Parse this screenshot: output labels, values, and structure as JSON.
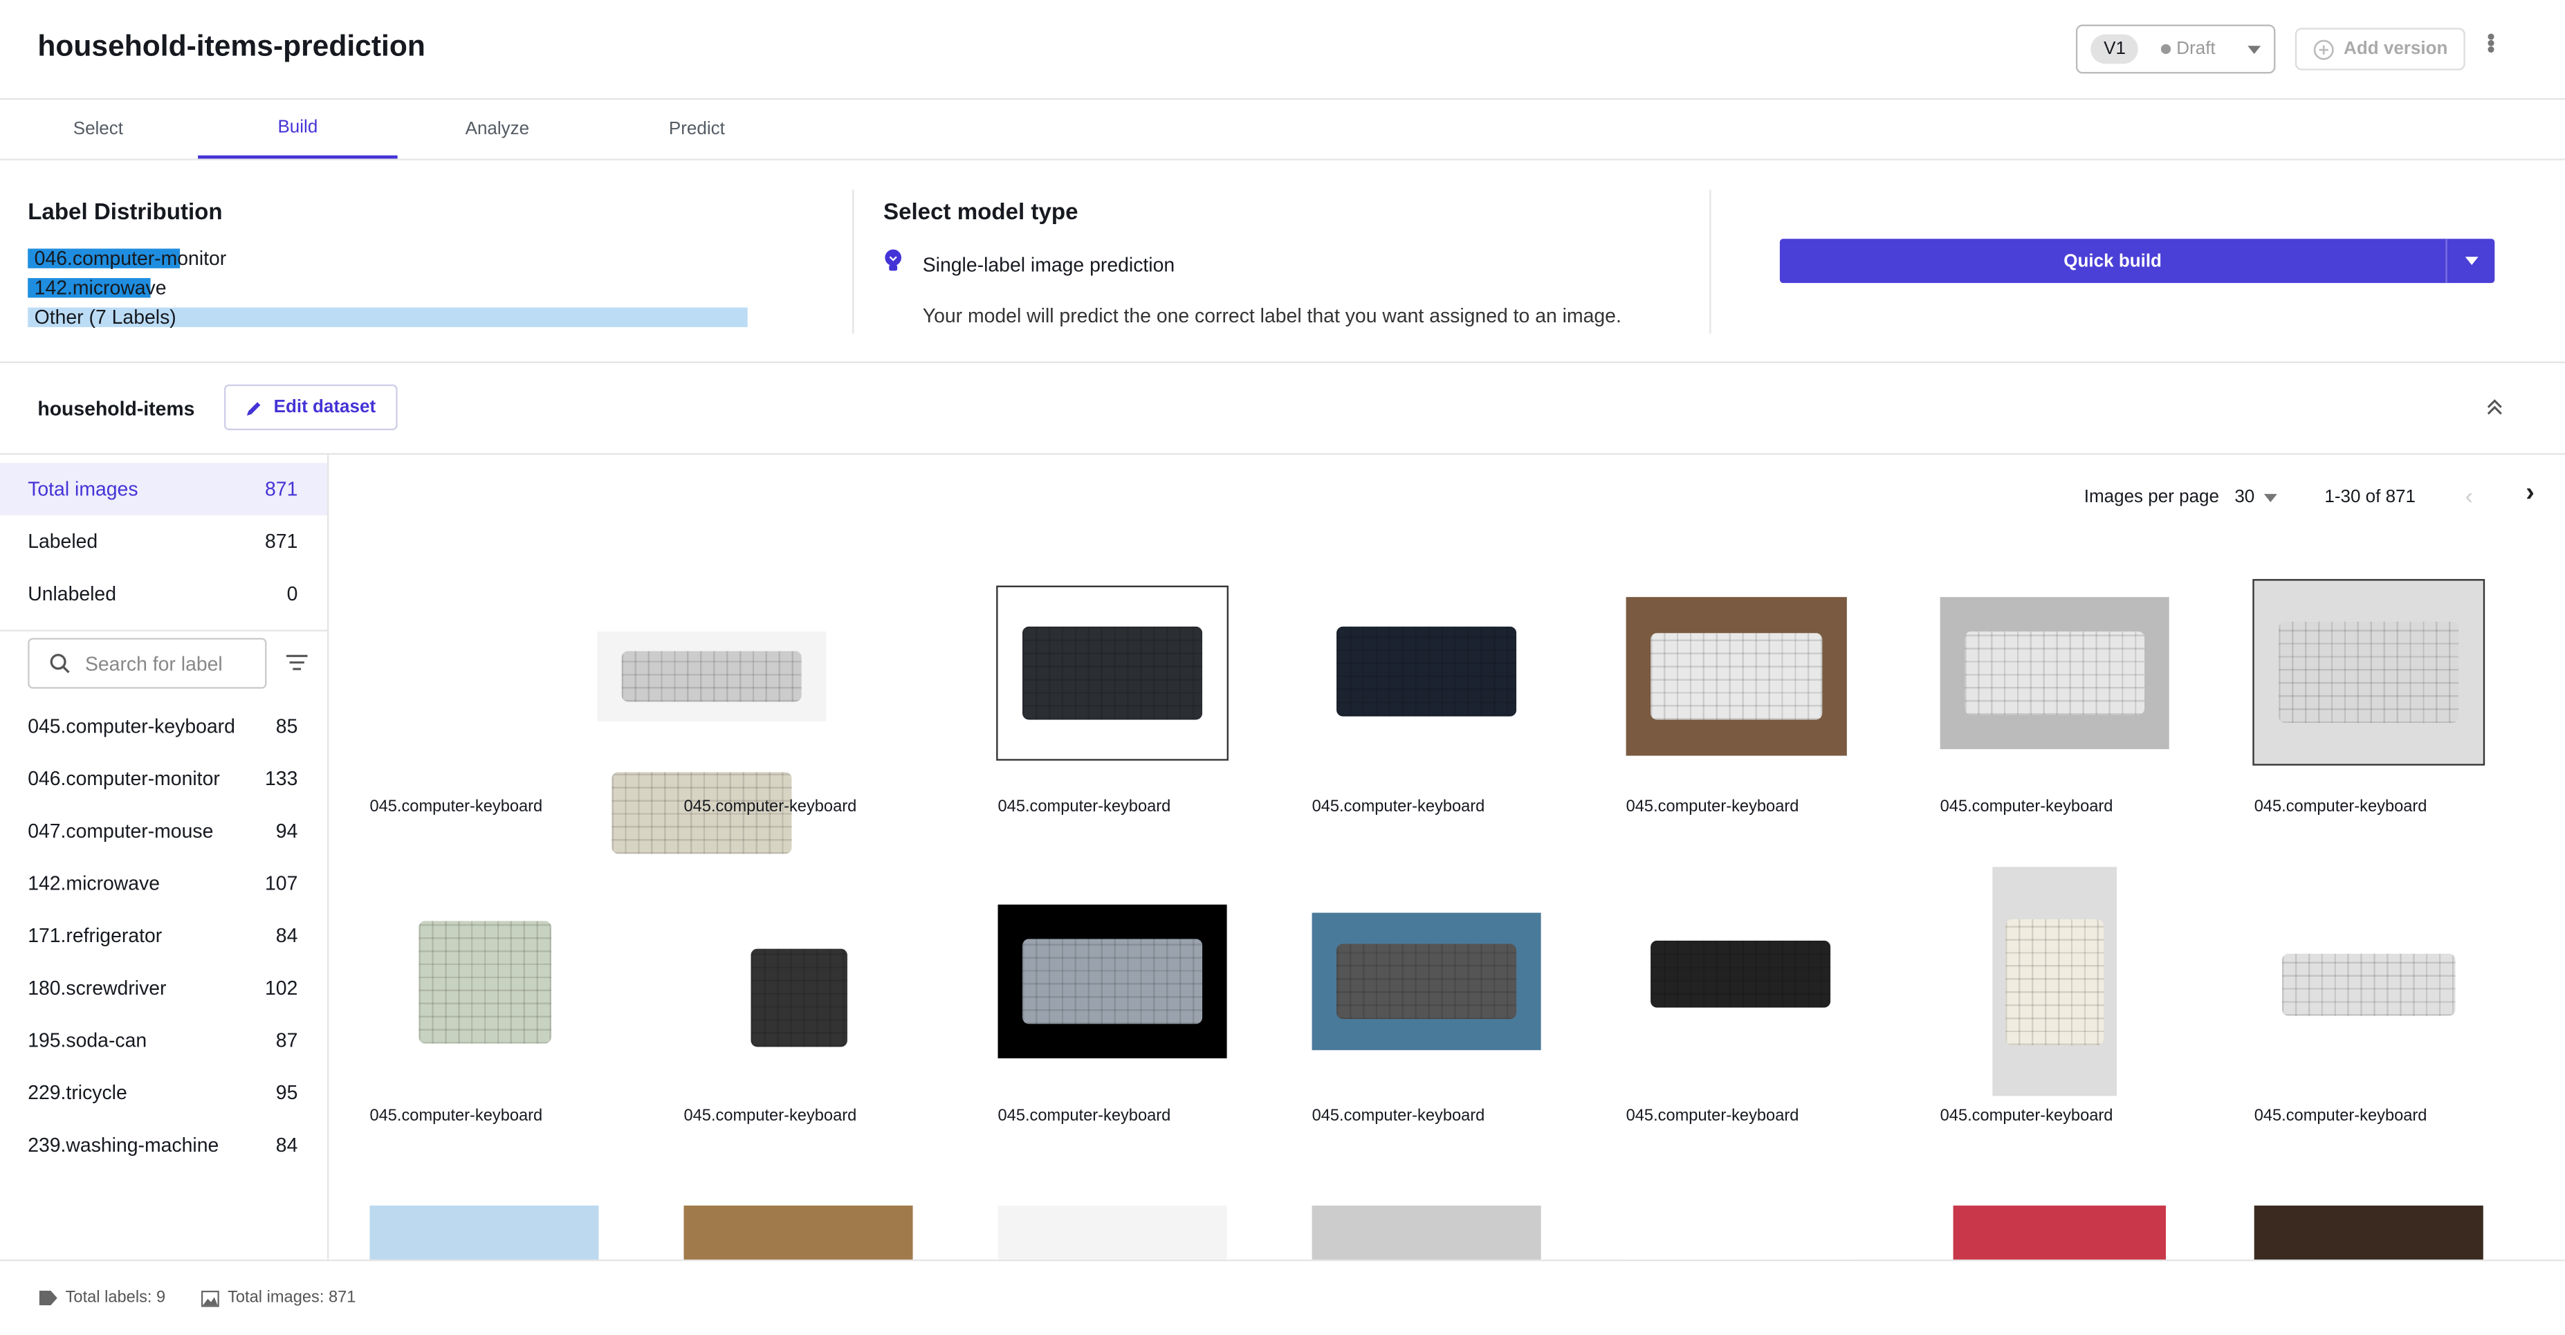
{
  "header": {
    "title": "household-items-prediction",
    "version": "V1",
    "status": "Draft",
    "add_version": "Add version"
  },
  "tabs": [
    {
      "label": "Select"
    },
    {
      "label": "Build",
      "active": true
    },
    {
      "label": "Analyze"
    },
    {
      "label": "Predict"
    }
  ],
  "label_distribution": {
    "title": "Label Distribution",
    "bars": [
      {
        "label": "046.computer-monitor",
        "count": 133,
        "color": "#1f8ee0"
      },
      {
        "label": "142.microwave",
        "count": 107,
        "color": "#1f8ee0"
      },
      {
        "label": "Other (7 Labels)",
        "count": 631,
        "color": "#bcdcf5"
      }
    ]
  },
  "model_type": {
    "title": "Select model type",
    "option": "Single-label image prediction",
    "description": "Your model will predict the one correct label that you want assigned to an image."
  },
  "build": {
    "quick_build": "Quick build"
  },
  "dataset": {
    "name": "household-items",
    "edit": "Edit dataset"
  },
  "stats": [
    {
      "label": "Total images",
      "value": "871",
      "active": true
    },
    {
      "label": "Labeled",
      "value": "871"
    },
    {
      "label": "Unlabeled",
      "value": "0"
    }
  ],
  "search": {
    "placeholder": "Search for label"
  },
  "labels": [
    {
      "name": "045.computer-keyboard",
      "count": "85"
    },
    {
      "name": "046.computer-monitor",
      "count": "133"
    },
    {
      "name": "047.computer-mouse",
      "count": "94"
    },
    {
      "name": "142.microwave",
      "count": "107"
    },
    {
      "name": "171.refrigerator",
      "count": "84"
    },
    {
      "name": "180.screwdriver",
      "count": "102"
    },
    {
      "name": "195.soda-can",
      "count": "87"
    },
    {
      "name": "229.tricycle",
      "count": "95"
    },
    {
      "name": "239.washing-machine",
      "count": "84"
    }
  ],
  "pagination": {
    "per_page_label": "Images per page",
    "per_page": "30",
    "range": "1-30 of 871"
  },
  "images": [
    "045.computer-keyboard",
    "045.computer-keyboard",
    "045.computer-keyboard",
    "045.computer-keyboard",
    "045.computer-keyboard",
    "045.computer-keyboard",
    "045.computer-keyboard",
    "045.computer-keyboard",
    "045.computer-keyboard",
    "045.computer-keyboard",
    "045.computer-keyboard",
    "045.computer-keyboard",
    "045.computer-keyboard",
    "045.computer-keyboard"
  ],
  "footer": {
    "total_labels": "Total labels: 9",
    "total_images": "Total images: 871"
  },
  "colors": {
    "accent": "#4433d6",
    "button": "#4a3fd6"
  }
}
